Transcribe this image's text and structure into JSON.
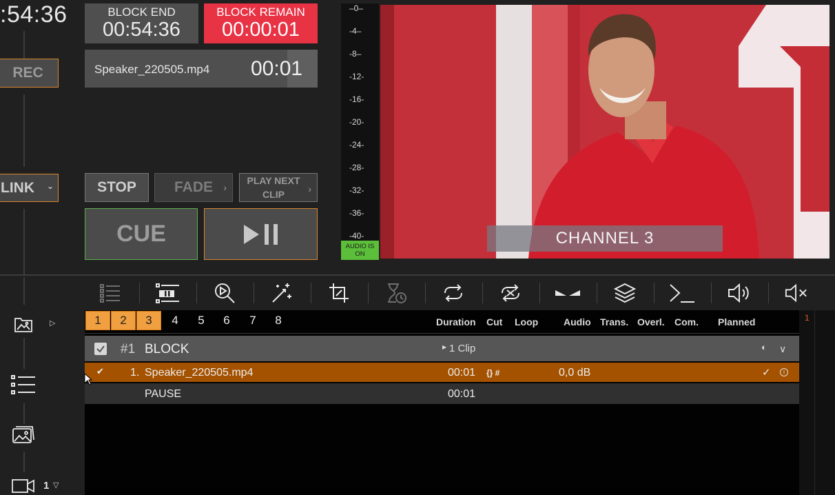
{
  "clock": ":54:36",
  "rec": "REC",
  "link": "LINK",
  "block_end": {
    "label": "BLOCK END",
    "value": "00:54:36"
  },
  "block_remain": {
    "label": "BLOCK REMAIN",
    "value": "00:00:01"
  },
  "current_clip": {
    "name": "Speaker_220505.mp4",
    "time": "00:01"
  },
  "controls": {
    "stop": "STOP",
    "fade": "FADE",
    "play_next": "PLAY NEXT CLIP",
    "cue": "CUE"
  },
  "meter": {
    "ticks": [
      "–0–",
      "-4–",
      "-8–",
      "-12-",
      "-16-",
      "-20-",
      "-24-",
      "-28-",
      "-32-",
      "-36-",
      "-40-"
    ],
    "audio_status": "AUDIO IS ON"
  },
  "preview": {
    "channel": "CHANNEL 3"
  },
  "toolbar": [
    "list-icon",
    "pause-list-icon",
    "search-play-icon",
    "magic-wand-icon",
    "crop-icon",
    "hourglass-icon",
    "repeat-icon",
    "shuffle-icon",
    "transition-icon",
    "layers-icon",
    "terminal-icon",
    "volume-icon",
    "mute-icon"
  ],
  "playlist": {
    "tabs": [
      "1",
      "2",
      "3",
      "4",
      "5",
      "6",
      "7",
      "8"
    ],
    "active_tabs": 3,
    "columns": {
      "duration": "Duration",
      "cut": "Cut",
      "loop": "Loop",
      "audio": "Audio",
      "trans": "Trans.",
      "overl": "Overl.",
      "com": "Com.",
      "planned": "Planned"
    },
    "block": {
      "number": "#1",
      "name": "BLOCK",
      "clips": "1 Clip"
    },
    "clip": {
      "index": "1.",
      "name": "Speaker_220505.mp4",
      "duration": "00:01",
      "cut": "{} #",
      "audio": "0,0 dB"
    },
    "pause": {
      "name": "PAUSE",
      "duration": "00:01"
    },
    "side_number": "1"
  },
  "camera": {
    "number": "1"
  },
  "colors": {
    "accent": "#f0a040",
    "remain_red": "#e83345",
    "clip_row": "#a55200",
    "audio_green": "#5cbf3a",
    "cue_border": "#5bb04a"
  }
}
